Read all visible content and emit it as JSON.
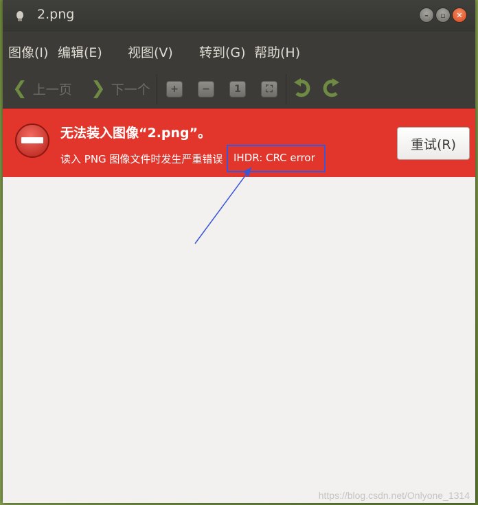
{
  "window": {
    "title": "2.png"
  },
  "menu": [
    {
      "label": "图像(I)"
    },
    {
      "label": "编辑(E)"
    },
    {
      "label": "视图(V)"
    },
    {
      "label": "转到(G)"
    },
    {
      "label": "帮助(H)"
    }
  ],
  "toolbar": {
    "prev_label": "上一页",
    "next_label": "下一个"
  },
  "error": {
    "title": "无法装入图像“2.png”。",
    "detail": "读入 PNG 图像文件时发生严重错误",
    "code": "IHDR: CRC error",
    "retry_label": "重试(R)"
  },
  "colors": {
    "error_bar": "#e2352b",
    "annotation": "#3a57d6",
    "nav_arrow": "#6f8a42"
  },
  "icons": {
    "app": "viewer-icon",
    "zoom_in": "zoom-in-icon",
    "zoom_out": "zoom-out-icon",
    "normal_size": "normal-size-icon",
    "best_fit": "best-fit-icon",
    "rotate_left": "rotate-left-icon",
    "rotate_right": "rotate-right-icon",
    "error": "error-icon"
  },
  "watermark": "https://blog.csdn.net/Onlyone_1314"
}
